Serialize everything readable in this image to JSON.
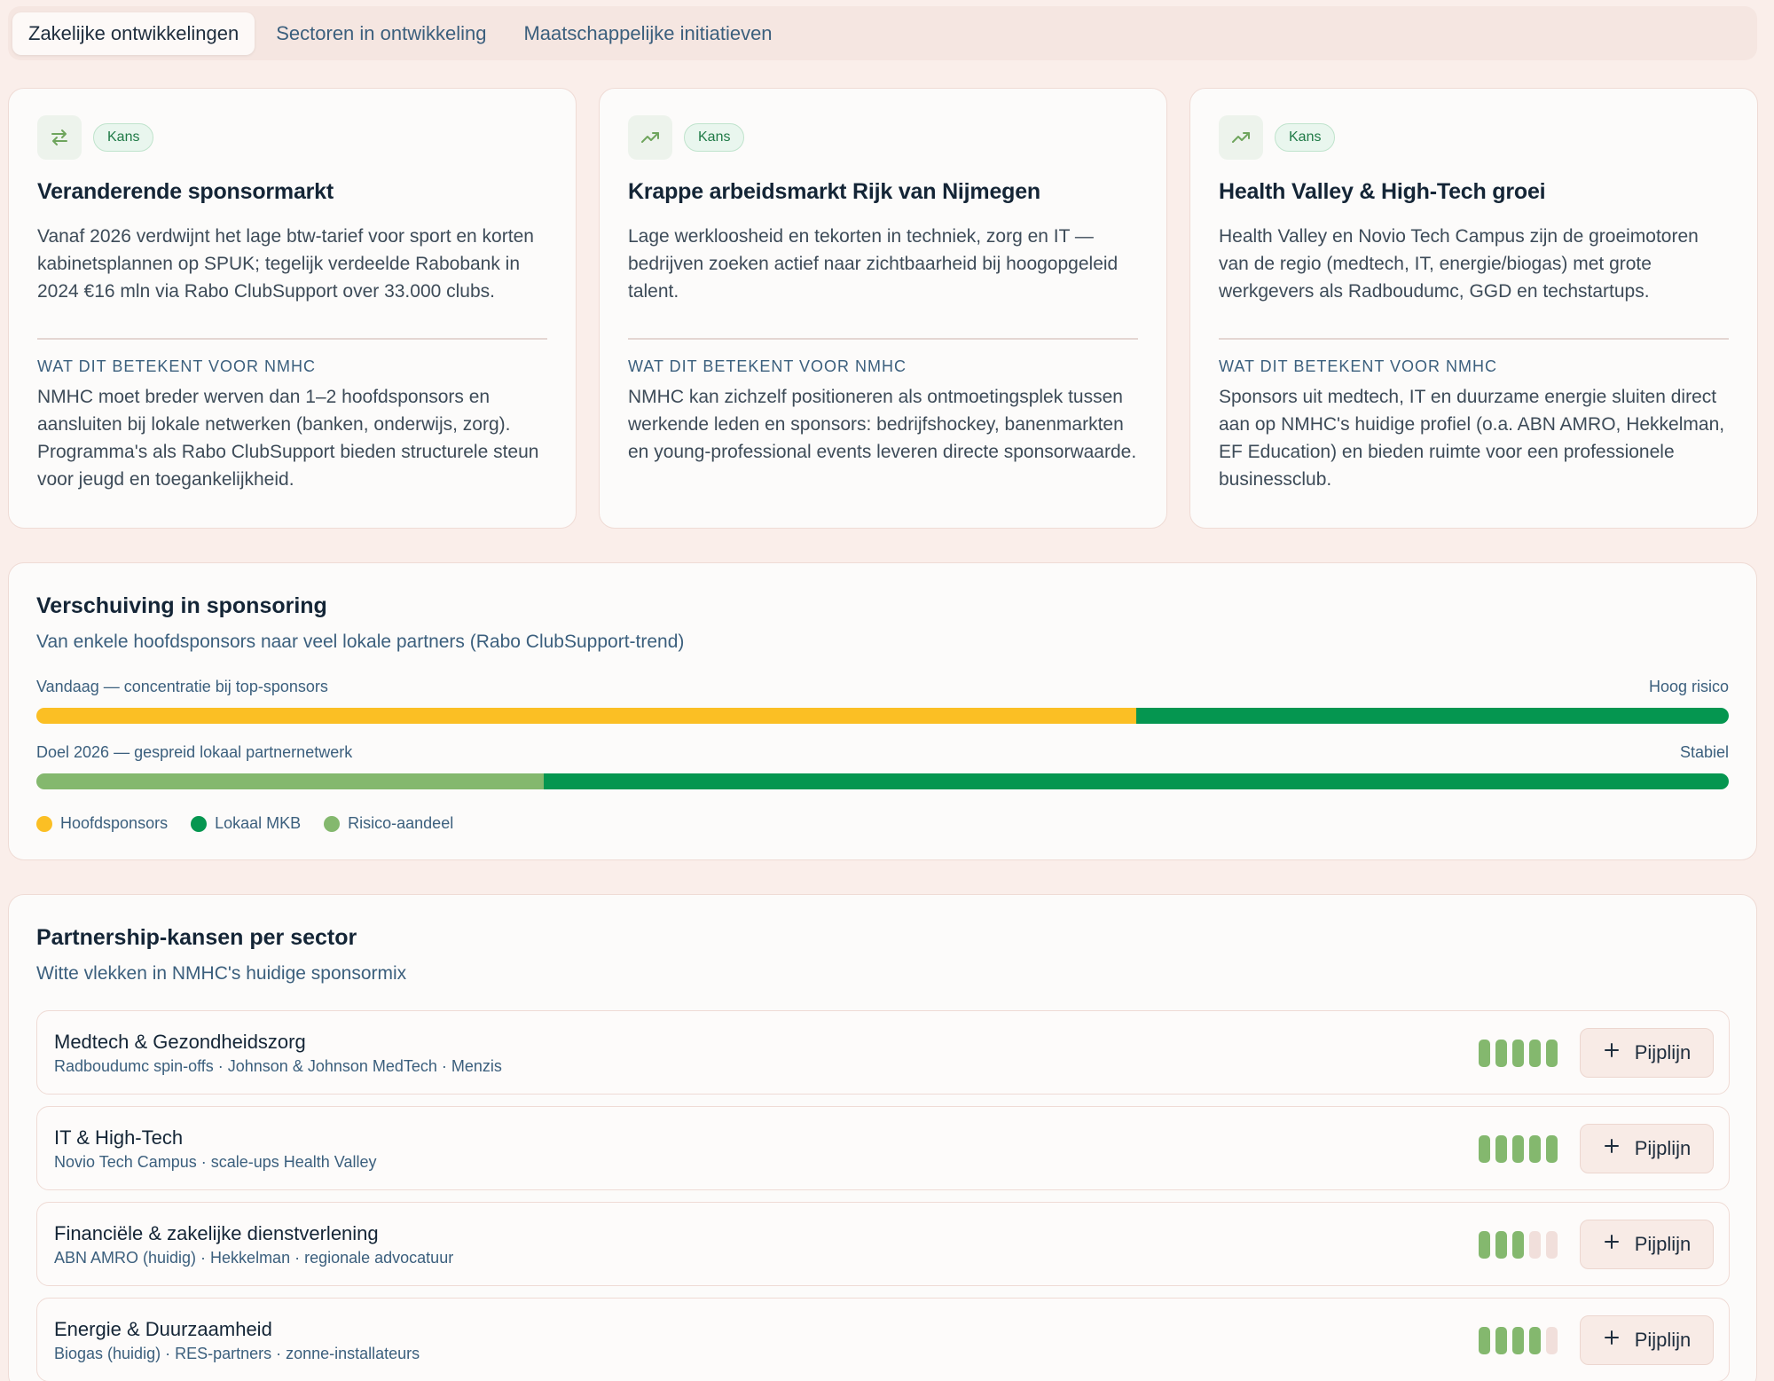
{
  "tabs": [
    {
      "label": "Zakelijke ontwikkelingen",
      "active": true
    },
    {
      "label": "Sectoren in ontwikkeling",
      "active": false
    },
    {
      "label": "Maatschappelijke initiatieven",
      "active": false
    }
  ],
  "trends": [
    {
      "icon": "swap-arrows-icon",
      "badge": "Kans",
      "title": "Veranderende sponsormarkt",
      "description": "Vanaf 2026 verdwijnt het lage btw-tarief voor sport en korten kabinetsplannen op SPUK; tegelijk verdeelde Rabobank in 2024 €16 mln via Rabo ClubSupport over 33.000 clubs.",
      "meaning_label": "WAT DIT BETEKENT VOOR NMHC",
      "meaning": "NMHC moet breder werven dan 1–2 hoofdsponsors en aansluiten bij lokale netwerken (banken, onderwijs, zorg). Programma's als Rabo ClubSupport bieden structurele steun voor jeugd en toegankelijkheid."
    },
    {
      "icon": "trending-up-icon",
      "badge": "Kans",
      "title": "Krappe arbeidsmarkt Rijk van Nijmegen",
      "description": "Lage werkloosheid en tekorten in techniek, zorg en IT — bedrijven zoeken actief naar zichtbaarheid bij hoogopgeleid talent.",
      "meaning_label": "WAT DIT BETEKENT VOOR NMHC",
      "meaning": "NMHC kan zichzelf positioneren als ontmoetingsplek tussen werkende leden en sponsors: bedrijfshockey, banenmarkten en young-professional events leveren directe sponsorwaarde."
    },
    {
      "icon": "trending-up-icon",
      "badge": "Kans",
      "title": "Health Valley & High-Tech groei",
      "description": "Health Valley en Novio Tech Campus zijn de groeimotoren van de regio (medtech, IT, energie/biogas) met grote werkgevers als Radboudumc, GGD en techstartups.",
      "meaning_label": "WAT DIT BETEKENT VOOR NMHC",
      "meaning": "Sponsors uit medtech, IT en duurzame energie sluiten direct aan op NMHC's huidige profiel (o.a. ABN AMRO, Hekkelman, EF Education) en bieden ruimte voor een professionele businessclub."
    }
  ],
  "shift": {
    "title": "Verschuiving in sponsoring",
    "subtitle": "Van enkele hoofdsponsors naar veel lokale partners (Rabo ClubSupport-trend)",
    "bars": [
      {
        "label": "Vandaag — concentratie bij top-sponsors",
        "status": "Hoog risico",
        "segments": [
          {
            "key": "Hoofdsponsors",
            "percent": 65,
            "color": "#fbbf24"
          },
          {
            "key": "Lokaal MKB",
            "percent": 35,
            "color": "#059650"
          }
        ]
      },
      {
        "label": "Doel 2026 — gespreid lokaal partnernetwerk",
        "status": "Stabiel",
        "segments": [
          {
            "key": "Risico-aandeel",
            "percent": 30,
            "color": "#84b86e"
          },
          {
            "key": "Lokaal MKB",
            "percent": 70,
            "color": "#059650"
          }
        ]
      }
    ],
    "legend": [
      {
        "label": "Hoofdsponsors",
        "color": "#fbbf24"
      },
      {
        "label": "Lokaal MKB",
        "color": "#059650"
      },
      {
        "label": "Risico-aandeel",
        "color": "#84b86e"
      }
    ]
  },
  "partnerships": {
    "title": "Partnership-kansen per sector",
    "subtitle": "Witte vlekken in NMHC's huidige sponsormix",
    "button_label": "Pijplijn",
    "rows": [
      {
        "name": "Medtech & Gezondheidszorg",
        "examples": "Radboudumc spin-offs · Johnson & Johnson MedTech · Menzis",
        "score": 5,
        "max": 5
      },
      {
        "name": "IT & High-Tech",
        "examples": "Novio Tech Campus · scale-ups Health Valley",
        "score": 5,
        "max": 5
      },
      {
        "name": "Financiële & zakelijke dienstverlening",
        "examples": "ABN AMRO (huidig) · Hekkelman · regionale advocatuur",
        "score": 3,
        "max": 5
      },
      {
        "name": "Energie & Duurzaamheid",
        "examples": "Biogas (huidig) · RES-partners · zonne-installateurs",
        "score": 4,
        "max": 5
      }
    ]
  }
}
